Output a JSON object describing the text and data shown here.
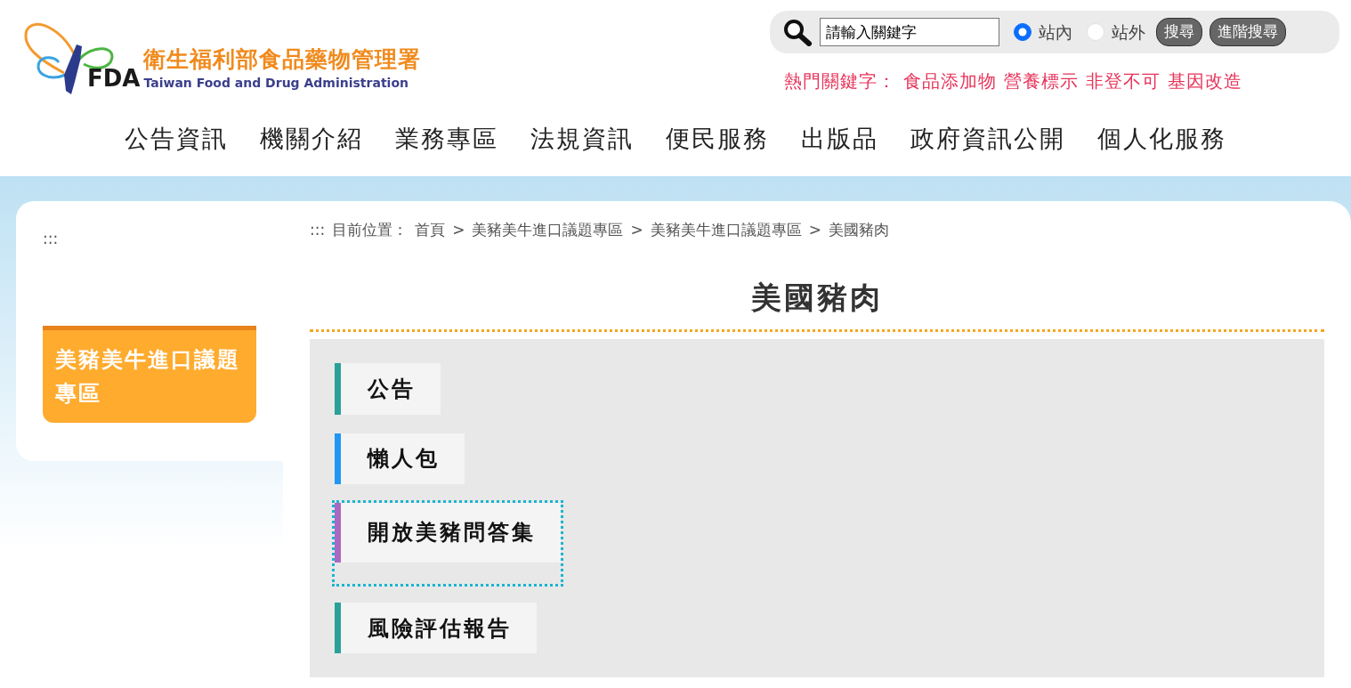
{
  "header": {
    "logo_title": "衛生福利部食品藥物管理署",
    "logo_subtitle": "Taiwan Food and Drug Administration",
    "logo_mark": "FDA"
  },
  "search": {
    "value": "請輸入關鍵字",
    "scopes": [
      {
        "label": "站內",
        "selected": true
      },
      {
        "label": "站外",
        "selected": false
      }
    ],
    "buttons": [
      "搜尋",
      "進階搜尋"
    ]
  },
  "hot_keywords": {
    "label": "熱門關鍵字：",
    "items": [
      "食品添加物",
      "營養標示",
      "非登不可",
      "基因改造"
    ]
  },
  "nav": [
    "公告資訊",
    "機關介紹",
    "業務專區",
    "法規資訊",
    "便民服務",
    "出版品",
    "政府資訊公開",
    "個人化服務"
  ],
  "sidebar": {
    "accesskey": ":::",
    "items": [
      {
        "label": "美豬美牛進口議題專區",
        "selected": true
      }
    ]
  },
  "breadcrumb": {
    "accesskey": ":::",
    "label": "目前位置：",
    "items": [
      "首頁",
      "美豬美牛進口議題專區",
      "美豬美牛進口議題專區",
      "美國豬肉"
    ],
    "separator": ">"
  },
  "page_title": "美國豬肉",
  "links": [
    {
      "label": "公告",
      "color": "#2aa198",
      "focused": false
    },
    {
      "label": "懶人包",
      "color": "#2196f3",
      "focused": false
    },
    {
      "label": "開放美豬問答集",
      "color": "#ab68c2",
      "focused": true
    },
    {
      "label": "風險評估報告",
      "color": "#2aa198",
      "focused": false
    }
  ]
}
